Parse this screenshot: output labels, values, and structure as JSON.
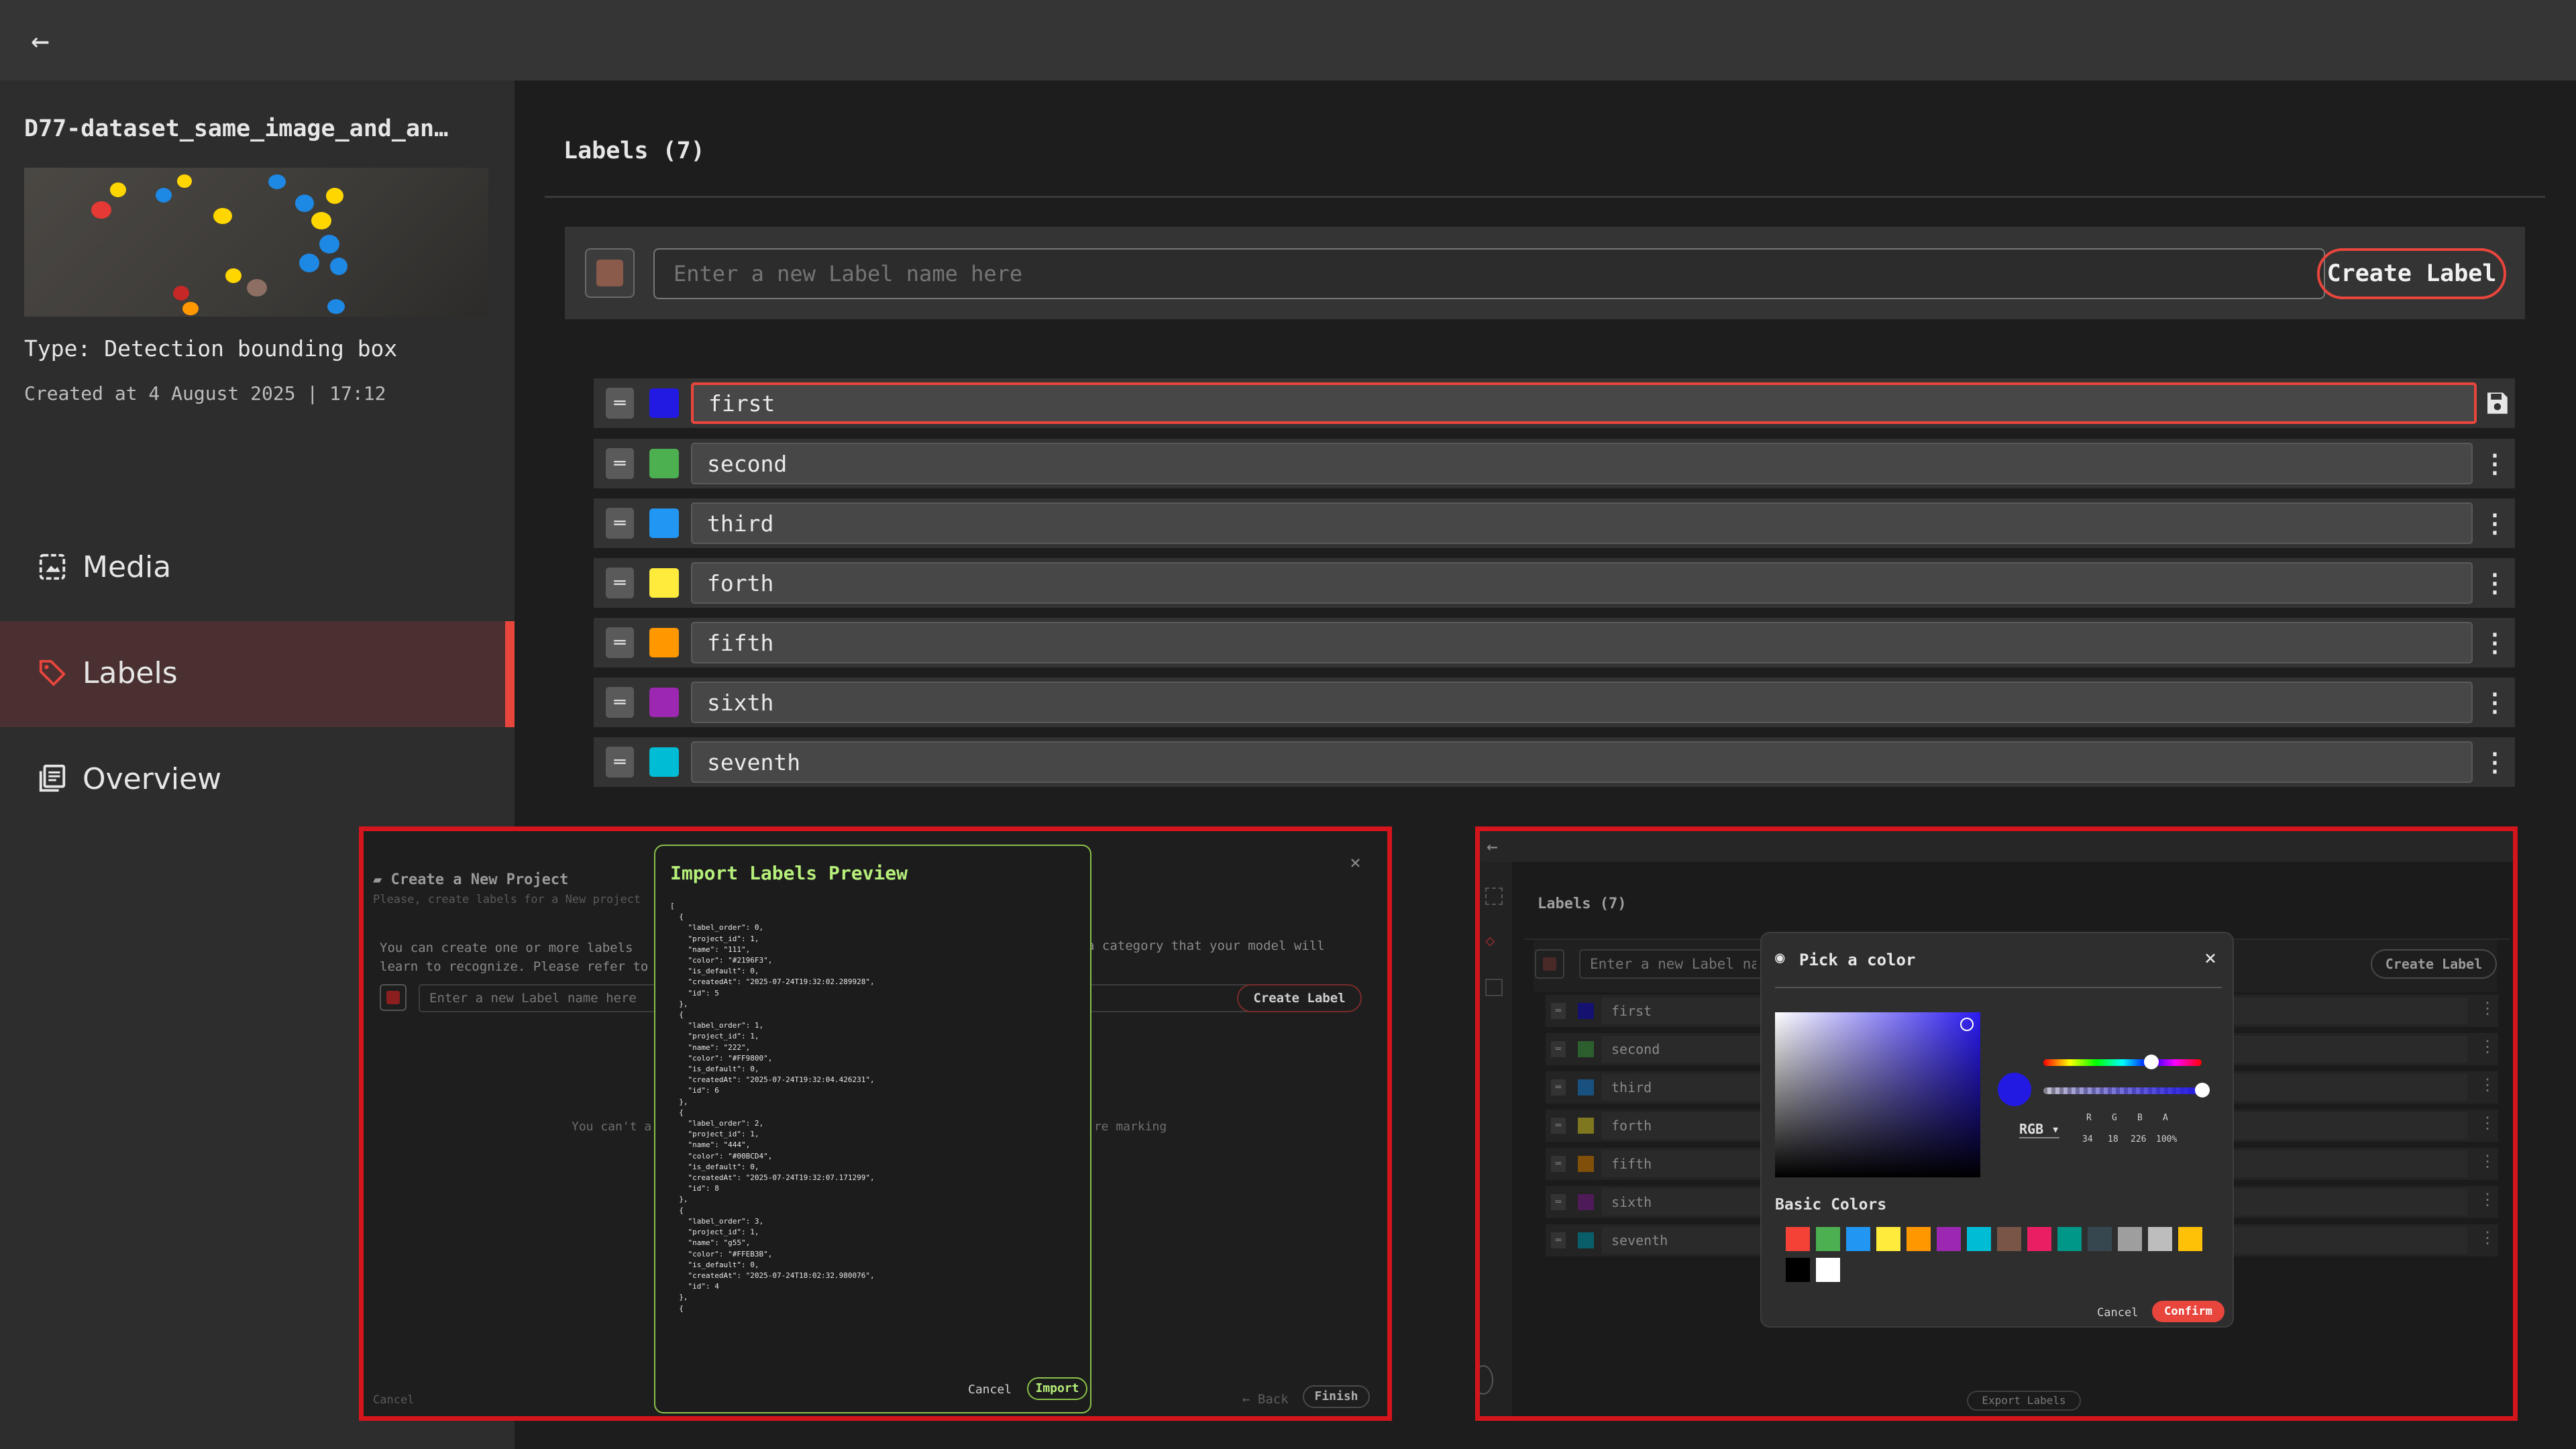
{
  "topbar": {
    "back_icon": "arrow-left-icon"
  },
  "project": {
    "title": "D77-dataset_same_image_and_an…",
    "type": "Type: Detection bounding box",
    "created": "Created at 4 August 2025 | 17:12"
  },
  "nav": [
    {
      "label": "Media",
      "icon": "media-icon",
      "active": false
    },
    {
      "label": "Labels",
      "icon": "tag-icon",
      "active": true
    },
    {
      "label": "Overview",
      "icon": "overview-icon",
      "active": false
    }
  ],
  "main": {
    "title": "Labels (7)",
    "new_label_placeholder": "Enter a new Label name here",
    "new_label_color": "#8a5a4a",
    "create_label": "Create Label"
  },
  "labels": [
    {
      "name": "first",
      "color": "#2219e2"
    },
    {
      "name": "second",
      "color": "#4caf50"
    },
    {
      "name": "third",
      "color": "#2196f3"
    },
    {
      "name": "forth",
      "color": "#ffeb3b"
    },
    {
      "name": "fifth",
      "color": "#ff9800"
    },
    {
      "name": "sixth",
      "color": "#9c27b0"
    },
    {
      "name": "seventh",
      "color": "#00bcd4"
    }
  ],
  "accent_color": "#e8463d",
  "inset_left": {
    "dialog_title": "Create a New Project",
    "dialog_subtitle": "Please, create labels for a New project",
    "desc_left": "You can create one or more labels\nlearn to recognize. Please refer to",
    "desc_right": "a category that your model will",
    "input_placeholder": "Enter a new Label name here",
    "create_label": "Create Label",
    "center_left": "You can't a",
    "center_right": "'re marking",
    "cancel": "Cancel",
    "back": "← Back",
    "finish": "Finish",
    "preview": {
      "title": "Import Labels Preview",
      "code": "[\n  {\n    \"label_order\": 0,\n    \"project_id\": 1,\n    \"name\": \"111\",\n    \"color\": \"#2196F3\",\n    \"is_default\": 0,\n    \"createdAt\": \"2025-07-24T19:32:02.289928\",\n    \"id\": 5\n  },\n  {\n    \"label_order\": 1,\n    \"project_id\": 1,\n    \"name\": \"222\",\n    \"color\": \"#FF9800\",\n    \"is_default\": 0,\n    \"createdAt\": \"2025-07-24T19:32:04.426231\",\n    \"id\": 6\n  },\n  {\n    \"label_order\": 2,\n    \"project_id\": 1,\n    \"name\": \"444\",\n    \"color\": \"#00BCD4\",\n    \"is_default\": 0,\n    \"createdAt\": \"2025-07-24T19:32:07.171299\",\n    \"id\": 8\n  },\n  {\n    \"label_order\": 3,\n    \"project_id\": 1,\n    \"name\": \"g55\",\n    \"color\": \"#FFEB3B\",\n    \"is_default\": 0,\n    \"createdAt\": \"2025-07-24T18:02:32.980076\",\n    \"id\": 4\n  },\n  {",
      "cancel": "Cancel",
      "import": "Import"
    }
  },
  "inset_right": {
    "title": "Labels (7)",
    "input_placeholder": "Enter a new Label name here",
    "create_label": "Create Label",
    "export_labels": "Export Labels",
    "picker": {
      "title": "Pick a color",
      "mode": "RGB",
      "channels": [
        "R",
        "G",
        "B",
        "A"
      ],
      "values": [
        "34",
        "18",
        "226",
        "100%"
      ],
      "basic_colors_title": "Basic Colors",
      "basic_colors": [
        "#f44336",
        "#4caf50",
        "#2196f3",
        "#ffeb3b",
        "#ff9800",
        "#9c27b0",
        "#00bcd4",
        "#795548",
        "#e91e63",
        "#009688",
        "#37474f",
        "#9e9e9e",
        "#bdbdbd",
        "#ffc107",
        "#000000",
        "#ffffff"
      ],
      "selected_color": "#2219e2",
      "cancel": "Cancel",
      "confirm": "Confirm"
    }
  }
}
